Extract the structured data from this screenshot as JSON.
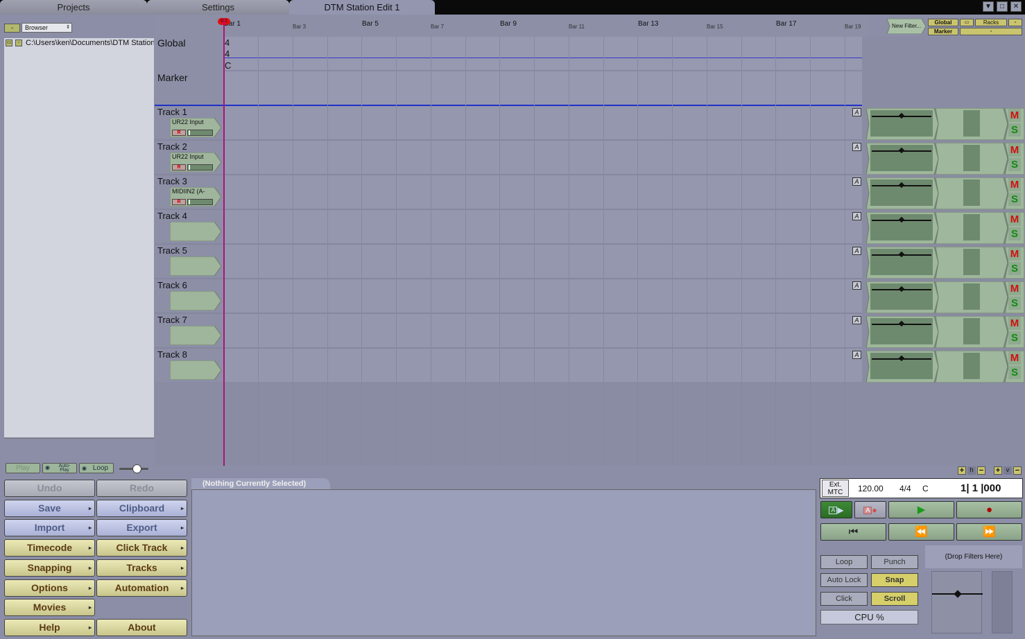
{
  "tabs": [
    {
      "label": "Projects",
      "active": false
    },
    {
      "label": "Settings",
      "active": false
    },
    {
      "label": "DTM Station Edit 1",
      "active": true
    }
  ],
  "window_controls": {
    "down": "▼",
    "max": "□",
    "close": "✕"
  },
  "browser": {
    "dropdown_value": "Browser",
    "path": "C:\\Users\\ken\\Documents\\DTM Station",
    "play_label": "Play",
    "autoplay_label": "Auto-Play",
    "loop_label": "Loop"
  },
  "ruler": {
    "major_bars": [
      "Bar 1",
      "Bar 5",
      "Bar 9",
      "Bar 13",
      "Bar 17"
    ],
    "minor_bars": [
      "Bar 3",
      "Bar 7",
      "Bar 11",
      "Bar 15",
      "Bar 19"
    ],
    "playhead_marker": "0 1"
  },
  "global_row": {
    "label": "Global",
    "sig_top": "4",
    "sig_bottom": "4",
    "key": "C"
  },
  "marker_row": {
    "label": "Marker"
  },
  "top_right": {
    "new_filter": "New Filter...",
    "global_btn": "Global",
    "marker_btn": "Marker",
    "racks_btn": "Racks"
  },
  "tracks": [
    {
      "name": "Track 1",
      "input": "UR22 Input",
      "record": "R"
    },
    {
      "name": "Track 2",
      "input": "UR22 Input",
      "record": "R"
    },
    {
      "name": "Track 3",
      "input": "MIDIIN2 (A-",
      "record": "R"
    },
    {
      "name": "Track 4",
      "input": "",
      "record": ""
    },
    {
      "name": "Track 5",
      "input": "",
      "record": ""
    },
    {
      "name": "Track 6",
      "input": "",
      "record": ""
    },
    {
      "name": "Track 7",
      "input": "",
      "record": ""
    },
    {
      "name": "Track 8",
      "input": "",
      "record": ""
    }
  ],
  "track_controls": {
    "auto": "A",
    "mute": "M",
    "solo": "S"
  },
  "zoom": {
    "h": "h",
    "v": "v",
    "plus": "+",
    "minus": "−"
  },
  "commands": [
    {
      "label": "Undo",
      "style": "gray",
      "arrow": false
    },
    {
      "label": "Redo",
      "style": "gray",
      "arrow": false
    },
    {
      "label": "Save",
      "style": "blue",
      "arrow": true
    },
    {
      "label": "Clipboard",
      "style": "blue",
      "arrow": true
    },
    {
      "label": "Import",
      "style": "blue",
      "arrow": true
    },
    {
      "label": "Export",
      "style": "blue",
      "arrow": true
    },
    {
      "label": "Timecode",
      "style": "gold",
      "arrow": true
    },
    {
      "label": "Click Track",
      "style": "gold",
      "arrow": true
    },
    {
      "label": "Snapping",
      "style": "gold",
      "arrow": true
    },
    {
      "label": "Tracks",
      "style": "gold",
      "arrow": true
    },
    {
      "label": "Options",
      "style": "gold",
      "arrow": true
    },
    {
      "label": "Automation",
      "style": "gold",
      "arrow": true
    },
    {
      "label": "Movies",
      "style": "gold",
      "arrow": true
    },
    {
      "label": "",
      "style": "none",
      "arrow": false
    },
    {
      "label": "Help",
      "style": "gold",
      "arrow": true
    },
    {
      "label": "About",
      "style": "gold",
      "arrow": false
    }
  ],
  "info": {
    "tab_label": "(Nothing Currently Selected)"
  },
  "transport": {
    "ext_mtc_line1": "Ext.",
    "ext_mtc_line2": "MTC",
    "tempo": "120.00",
    "time_sig": "4/4",
    "key": "C",
    "position": "1| 1 |000",
    "loop": "Loop",
    "punch": "Punch",
    "auto_lock": "Auto Lock",
    "snap": "Snap",
    "click": "Click",
    "scroll": "Scroll",
    "cpu": "CPU %",
    "drop_filters": "(Drop Filters Here)"
  }
}
